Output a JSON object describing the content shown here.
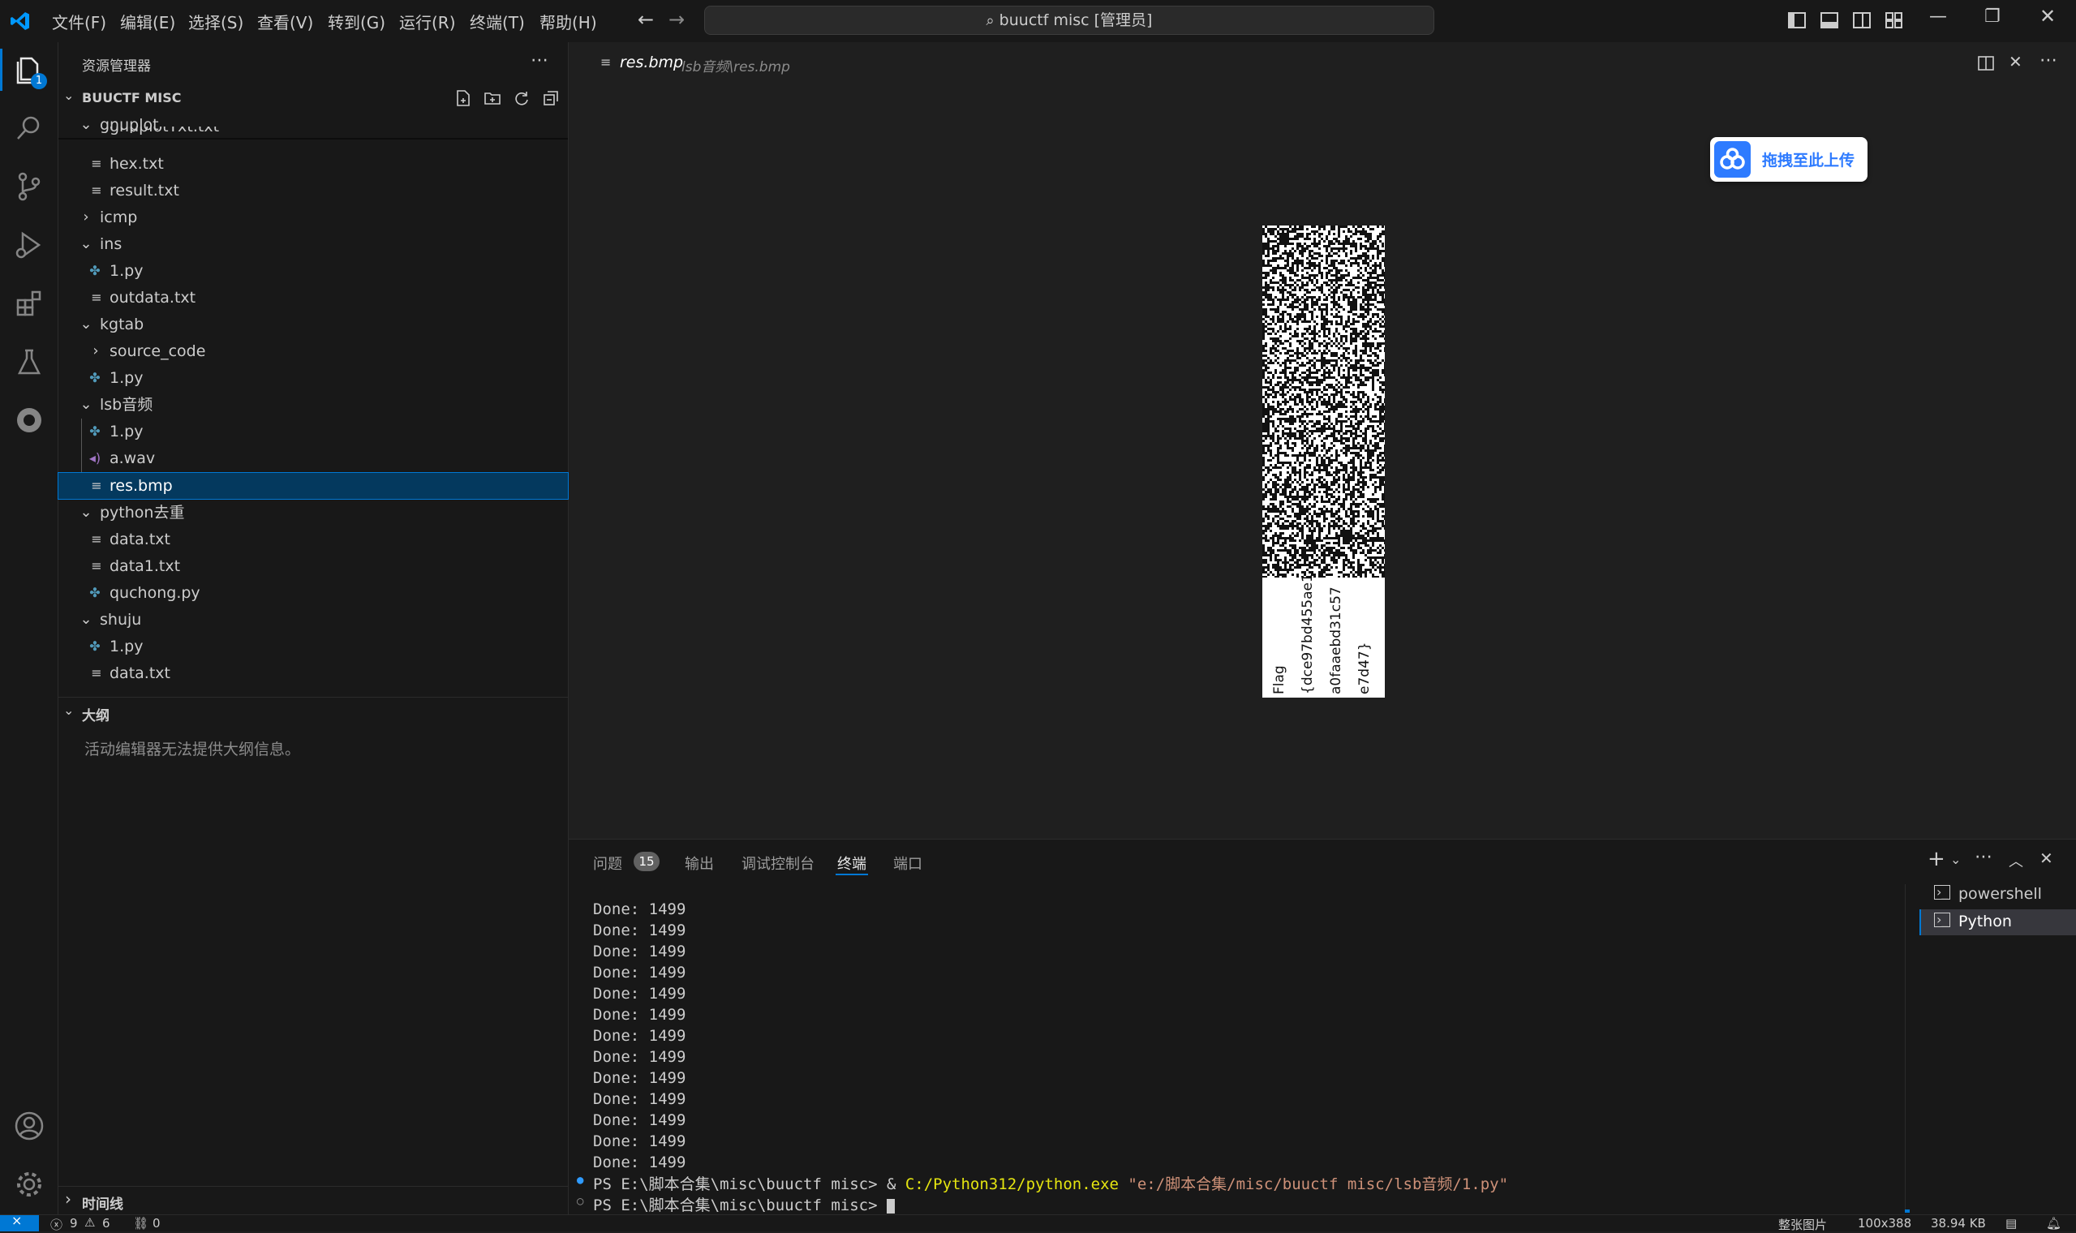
{
  "titlebar": {
    "menus": [
      "文件(F)",
      "编辑(E)",
      "选择(S)",
      "查看(V)",
      "转到(G)",
      "运行(R)",
      "终端(T)",
      "帮助(H)"
    ],
    "search_text": "buuctf misc [管理员]"
  },
  "activity": {
    "explorer_badge": "1"
  },
  "sidebar": {
    "header": "资源管理器",
    "root": "BUUCTF MISC",
    "items": [
      {
        "label": "gnuplot",
        "type": "folder-open"
      },
      {
        "label": "gnuplotTxt.txt",
        "type": "file"
      },
      {
        "label": "hex.txt",
        "type": "file"
      },
      {
        "label": "result.txt",
        "type": "file"
      },
      {
        "label": "icmp",
        "type": "folder-closed"
      },
      {
        "label": "ins",
        "type": "folder-open"
      },
      {
        "label": "1.py",
        "type": "python"
      },
      {
        "label": "outdata.txt",
        "type": "file"
      },
      {
        "label": "kgtab",
        "type": "folder-open"
      },
      {
        "label": "source_code",
        "type": "folder-closed"
      },
      {
        "label": "1.py",
        "type": "python"
      },
      {
        "label": "lsb音频",
        "type": "folder-open"
      },
      {
        "label": "1.py",
        "type": "python"
      },
      {
        "label": "a.wav",
        "type": "audio"
      },
      {
        "label": "res.bmp",
        "type": "file"
      },
      {
        "label": "python去重",
        "type": "folder-open"
      },
      {
        "label": "data.txt",
        "type": "file"
      },
      {
        "label": "data1.txt",
        "type": "file"
      },
      {
        "label": "quchong.py",
        "type": "python"
      },
      {
        "label": "shuju",
        "type": "folder-open"
      },
      {
        "label": "1.py",
        "type": "python"
      },
      {
        "label": "data.txt",
        "type": "file"
      }
    ],
    "outline_header": "大纲",
    "outline_empty": "活动编辑器无法提供大纲信息。",
    "timeline_header": "时间线"
  },
  "editor": {
    "tab_title": "res.bmp",
    "tab_path": "lsb音频\\res.bmp",
    "image_text_lines": [
      "Flag",
      "{dce97bd455ae1",
      "a0faaebd31c57",
      "e7d47}"
    ],
    "upload_button": "拖拽至此上传"
  },
  "panel": {
    "tabs": [
      "问题",
      "输出",
      "调试控制台",
      "终端",
      "端口"
    ],
    "problems_count": "15",
    "active_tab": "终端",
    "terminal_lines": [
      "Done: 1499",
      "Done: 1499",
      "Done: 1499",
      "Done: 1499",
      "Done: 1499",
      "Done: 1499",
      "Done: 1499",
      "Done: 1499",
      "Done: 1499",
      "Done: 1499",
      "Done: 1499",
      "Done: 1499",
      "Done: 1499"
    ],
    "cmd_prompt": "PS E:\\脚本合集\\misc\\buuctf misc> & ",
    "cmd_exe": "C:/Python312/python.exe",
    "cmd_arg": " \"e:/脚本合集/misc/buuctf misc/lsb音频/1.py\"",
    "last_prompt": "PS E:\\脚本合集\\misc\\buuctf misc> ",
    "terminals": [
      "powershell",
      "Python"
    ]
  },
  "statusbar": {
    "errors": "9",
    "warnings": "6",
    "ports": "0",
    "image_type": "整张图片",
    "dimensions": "100x388",
    "size": "38.94 KB"
  },
  "colors": {
    "accent": "#0078d4",
    "selection": "#04395e",
    "python_icon": "#519aba",
    "audio_icon": "#a074c4",
    "terminal_yellow": "#e5e510",
    "terminal_string": "#ce9178",
    "baidu_blue": "#2e7bff"
  }
}
